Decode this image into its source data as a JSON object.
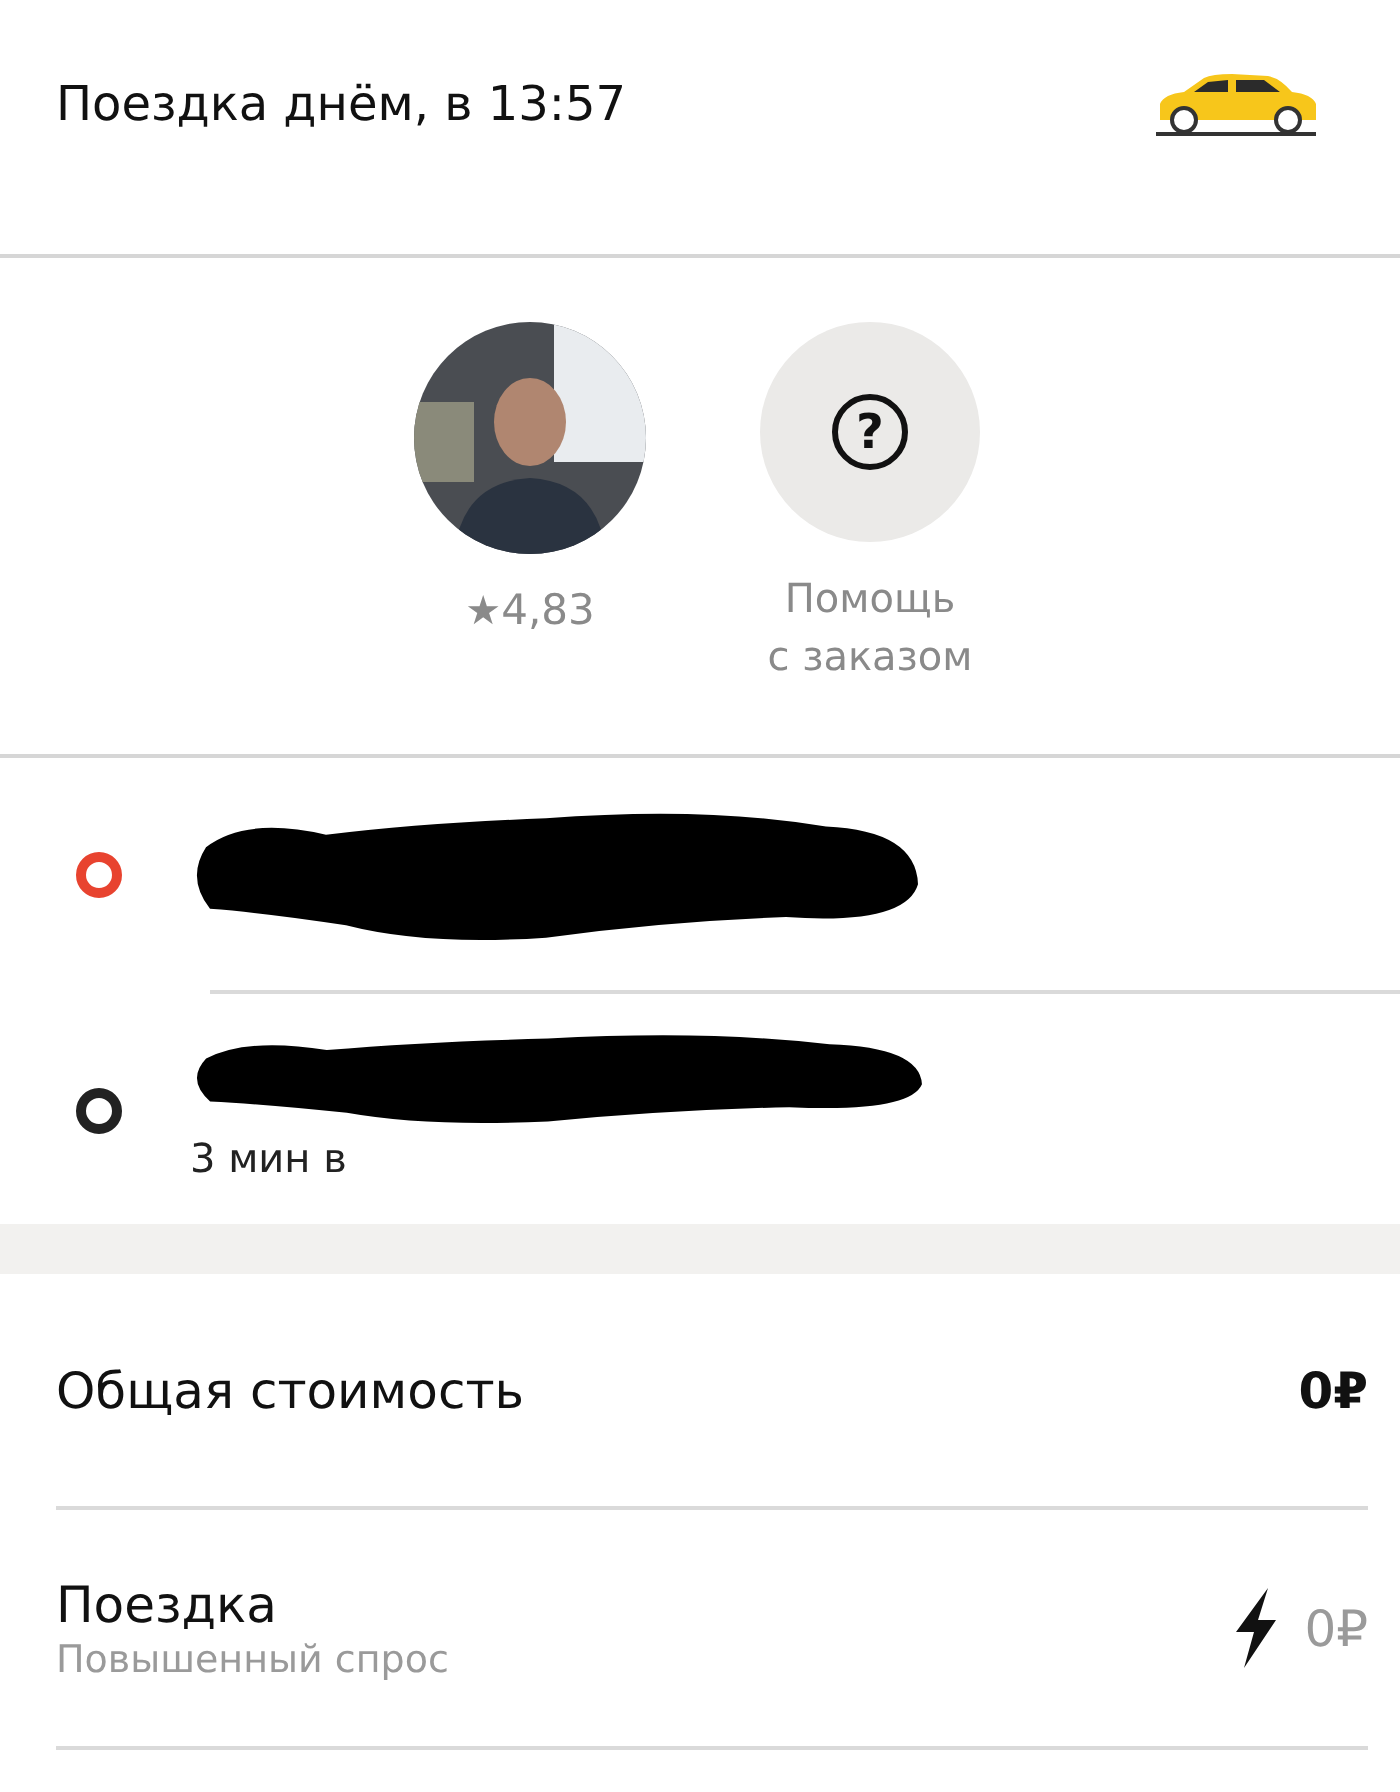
{
  "header": {
    "title": "Поездка днём, в 13:57"
  },
  "driver": {
    "rating_star": "★",
    "rating": "4,83"
  },
  "help": {
    "icon": "?",
    "label": "Помощь\nс заказом"
  },
  "route": [
    {
      "color": "#e8432f",
      "redacted": true
    },
    {
      "color": "#222222",
      "redacted": true,
      "subtitle": "3 мин в"
    }
  ],
  "cost": [
    {
      "kind": "total",
      "label": "Общая стоимость",
      "amount": "0₽"
    },
    {
      "kind": "item",
      "label": "Поездка",
      "sublabel": "Повышенный спрос",
      "surge": true,
      "amount": "0₽"
    }
  ]
}
